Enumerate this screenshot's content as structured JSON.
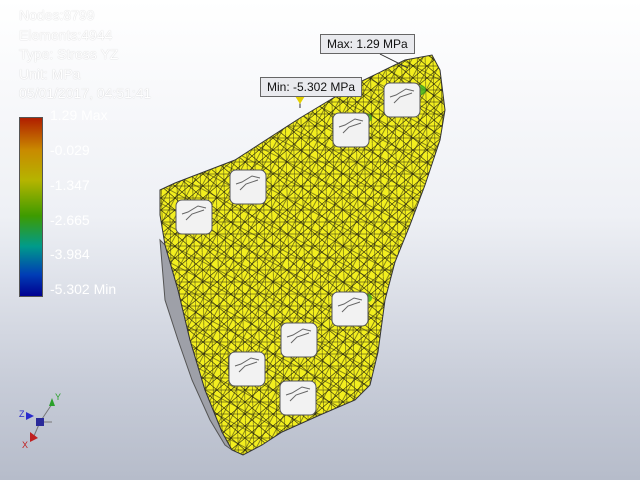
{
  "info": {
    "nodes": "Nodes:8799",
    "elements": "Elements:4944",
    "type": "Type: Stress YZ",
    "unit": "Unit: MPa",
    "datetime": "05/01/2017, 04:51:41"
  },
  "legend": {
    "labels": [
      "1.29 Max",
      "-0.029",
      "-1.347",
      "-2.665",
      "-3.984",
      "-5.302 Min"
    ],
    "colors": [
      "#b01e00",
      "#c98a00",
      "#b5b400",
      "#3d9b00",
      "#009b8a",
      "#003db5"
    ]
  },
  "callouts": {
    "max": "Max: 1.29 MPa",
    "min": "Min: -5.302 MPa"
  },
  "colors": {
    "mesh_fill": "#f2ee1f",
    "mesh_lines": "#202010",
    "hole_fill": "#f2f2f2"
  },
  "triad": {
    "x_label": "X",
    "y_label": "Y",
    "z_label": "Z"
  }
}
